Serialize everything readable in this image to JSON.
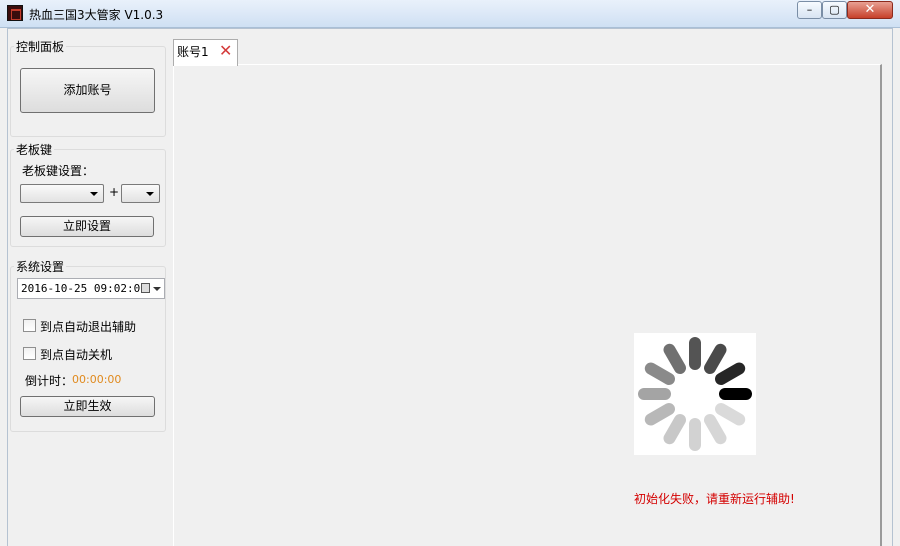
{
  "window": {
    "title": "热血三国3大管家 V1.0.3",
    "controls": {
      "minimize_icon": "minimize-icon",
      "maximize_icon": "restore-icon",
      "close_icon": "close-icon"
    }
  },
  "control_panel": {
    "group_label": "控制面板",
    "add_account_label": "添加账号"
  },
  "boss_key": {
    "group_label": "老板键",
    "settings_label": "老板键设置：",
    "modifier_value": "",
    "plus_sign": "+",
    "key_value": "",
    "apply_label": "立即设置"
  },
  "system_settings": {
    "group_label": "系统设置",
    "datetime_value": "2016-10-25 09:02:00",
    "auto_exit_label": "到点自动退出辅助",
    "auto_exit_checked": false,
    "auto_shutdown_label": "到点自动关机",
    "auto_shutdown_checked": false,
    "countdown_label": "倒计时：",
    "countdown_value": "00:00:00",
    "apply_label": "立即生效"
  },
  "tabs": [
    {
      "label": "账号1",
      "close_icon": "close-x-icon",
      "active": true
    }
  ],
  "main": {
    "loading_icon": "loading-spinner-icon",
    "status_message": "初始化失败，请重新运行辅助!"
  },
  "colors": {
    "status_message": "#d40000",
    "countdown_value": "#e08a1e",
    "tab_close": "#d43a3a"
  }
}
